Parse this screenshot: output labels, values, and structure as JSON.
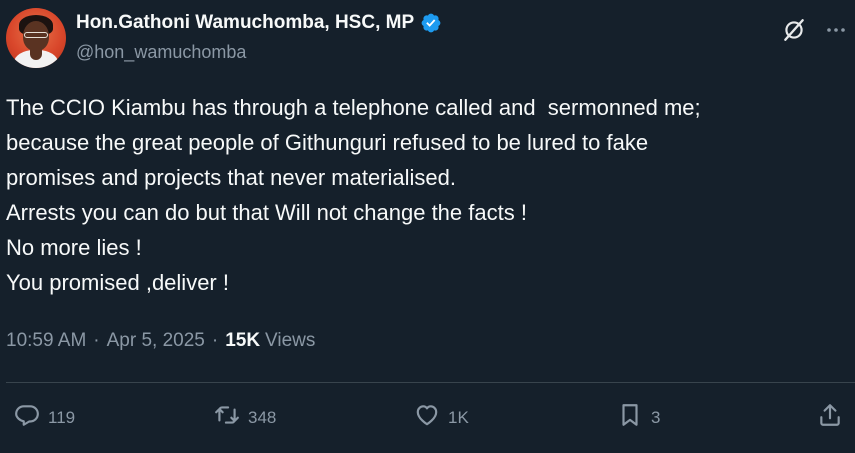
{
  "author": {
    "display_name": "Hon.Gathoni Wamuchomba, HSC, MP",
    "handle": "@hon_wamuchomba",
    "verified": true,
    "avatar_icon": "profile-photo"
  },
  "tweet": {
    "lines": [
      "The CCIO Kiambu has through a telephone called and  sermonned me;",
      "because the great people of Githunguri refused to be lured to fake",
      "promises and projects that never materialised.",
      "Arrests you can do but that Will not change the facts !",
      "No more lies !",
      "You promised ,deliver !"
    ]
  },
  "meta": {
    "time": "10:59 AM",
    "separator": "·",
    "date": "Apr 5, 2025",
    "views_count": "15K",
    "views_label": "Views"
  },
  "actions": {
    "reply_count": "119",
    "retweet_count": "348",
    "like_count": "1K",
    "bookmark_count": "3"
  },
  "icons": {
    "verified": "verified-badge-icon",
    "grok": "grok-icon",
    "more": "more-icon",
    "reply": "reply-icon",
    "retweet": "retweet-icon",
    "like": "heart-icon",
    "bookmark": "bookmark-icon",
    "share": "share-icon"
  },
  "colors": {
    "background": "#15202b",
    "text": "#f7f9f9",
    "secondary": "#8b98a5",
    "verified": "#1d9bf0",
    "divider": "#38444d"
  }
}
